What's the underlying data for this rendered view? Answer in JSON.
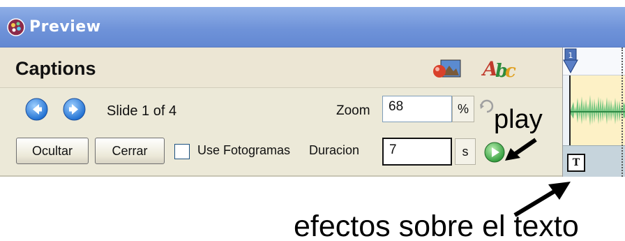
{
  "window": {
    "title": "Preview",
    "titlebar_color": "#6f93d9"
  },
  "panel": {
    "title": "Captions",
    "header_icons": [
      "image-effects-icon",
      "text-style-icon"
    ]
  },
  "navigation": {
    "prev_icon": "arrow-left-icon",
    "next_icon": "arrow-right-icon",
    "slide_label": "Slide 1 of 4"
  },
  "zoom": {
    "label": "Zoom",
    "value": "68",
    "unit": "%"
  },
  "buttons": {
    "hide": "Ocultar",
    "close": "Cerrar"
  },
  "checkbox": {
    "label": "Use Fotogramas",
    "checked": false
  },
  "duration": {
    "label": "Duracion",
    "value": "7",
    "unit": "s"
  },
  "timeline": {
    "marker_number": "1",
    "text_effects_icon": "T",
    "clip_color": "#fdf1c6",
    "wave_color": "#68c27a"
  },
  "annotations": {
    "play": "play",
    "text_effects": "efectos sobre el texto"
  }
}
